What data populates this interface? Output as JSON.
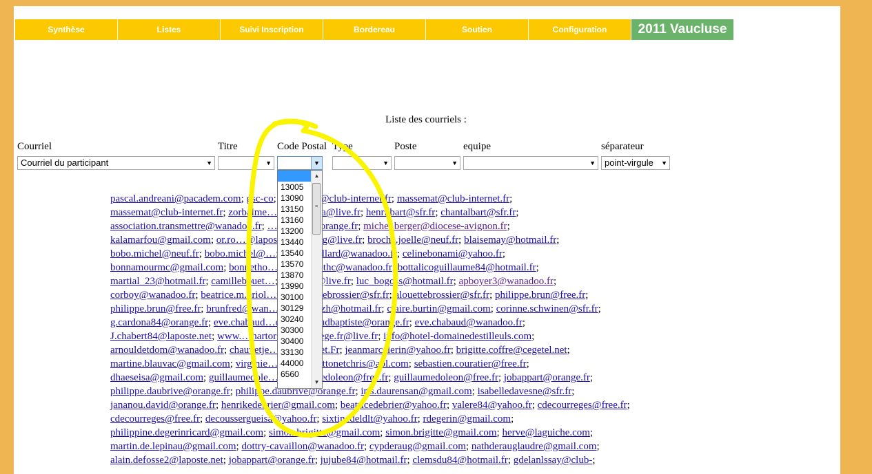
{
  "nav": {
    "items": [
      "Synthèse",
      "Listes",
      "Suivi Inscription",
      "Bordereau",
      "Soutien",
      "Configuration"
    ],
    "brand": "2011 Vaucluse"
  },
  "page_title": "Liste des courriels :",
  "filters": {
    "labels": [
      "Courriel",
      "Titre",
      "Code Postal",
      "Type",
      "Poste",
      "equipe",
      "séparateur"
    ],
    "courriel_value": "Courriel du participant",
    "separateur_value": "point-virgule"
  },
  "code_postal_options": [
    "",
    "13005",
    "13090",
    "13150",
    "13160",
    "13200",
    "13440",
    "13540",
    "13570",
    "13870",
    "13990",
    "30100",
    "30129",
    "30240",
    "30300",
    "30400",
    "33130",
    "44000",
    "6560"
  ],
  "emails": [
    [
      [
        "pascal.andreani@pacadem.com",
        ""
      ],
      [
        "gsc-co",
        "…wanadoo.fr",
        ""
      ],
      [
        "massemat@club-internet.fr",
        ""
      ],
      [
        "massemat@club-internet.fr",
        ""
      ]
    ],
    [
      [
        "massemat@club-internet.fr",
        ""
      ],
      [
        "zorbalme…ail.fr",
        ""
      ],
      [
        "arolla@live.fr",
        ""
      ],
      [
        "henri.bart@sfr.fr",
        ""
      ],
      [
        "chantalbart@sfr.fr",
        ""
      ]
    ],
    [
      [
        "association.transmettre@wanadoo.fr",
        ""
      ],
      [
        "…nique84@orange.fr",
        ""
      ],
      [
        "michel.berger@diocese-avignon.fr",
        "visited"
      ]
    ],
    [
      [
        "kalamarfou@gmail.com",
        ""
      ],
      [
        "or.ro…@lapos…",
        ""
      ],
      [
        "…yszog@live.fr",
        ""
      ],
      [
        "broche.joelle@neuf.fr",
        ""
      ],
      [
        "blaisemay@hotmail.fr",
        ""
      ]
    ],
    [
      [
        "bobo.michel@neuf.fr",
        ""
      ],
      [
        "bobo.michel@…",
        ""
      ],
      [
        "…cole.bollard@wanadoo.fr",
        ""
      ],
      [
        "celinebonami@yahoo.fr",
        ""
      ]
    ],
    [
      [
        "bonnamourmc@gmail.com",
        ""
      ],
      [
        "bonnetho…o.fr",
        ""
      ],
      [
        "bonnethc@wanadoo.fr",
        ""
      ],
      [
        "bottalicoguillaume84@hotmail.fr",
        ""
      ]
    ],
    [
      [
        "martial_23@hotmail.fr",
        ""
      ],
      [
        "camillebouet…",
        ""
      ],
      [
        "veran.84@live.fr",
        ""
      ],
      [
        "luc_bogoss@hotmail.fr",
        ""
      ],
      [
        "apboyer3@wanadoo.fr",
        "visited"
      ]
    ],
    [
      [
        "corboy@wanadoo.fr",
        ""
      ],
      [
        "beatrice.m.briol…r.fr",
        ""
      ],
      [
        "alouettebrossier@sfr.fr",
        ""
      ],
      [
        "alouettebrossier@sfr.fr",
        ""
      ],
      [
        "philippe.brun@free.fr",
        ""
      ]
    ],
    [
      [
        "philippe.brun@free.fr",
        ""
      ],
      [
        "brunfred@wan…",
        ""
      ],
      [
        "…nhbreizh@hotmail.fr",
        ""
      ],
      [
        "claire.burtin@gmail.com",
        ""
      ],
      [
        "corinne.schwinen@sfr.fr",
        ""
      ]
    ],
    [
      [
        "g.cardona84@orange.fr",
        ""
      ],
      [
        "eve.chabaud…o.fr",
        ""
      ],
      [
        "chabaudbaptiste@orange.fr",
        ""
      ],
      [
        "eve.chabaud@wanadoo.fr",
        ""
      ]
    ],
    [
      [
        "J.chabert84@laposte.net",
        ""
      ],
      [
        "www.…hartor…r.fr",
        ""
      ],
      [
        "nadege.fr@live.fr",
        ""
      ],
      [
        "info@hotel-domainedestilleuls.com",
        ""
      ]
    ],
    [
      [
        "arnouldetdom@wanadoo.fr",
        ""
      ],
      [
        "chauvetje…lub-internet.Fr",
        ""
      ],
      [
        "jeanmarcclerin@yahoo.fr",
        ""
      ],
      [
        "brigitte.coffre@cegetel.net",
        ""
      ]
    ],
    [
      [
        "martine.blauvac@gmail.com",
        ""
      ],
      [
        "virginie…@sfr.fr",
        ""
      ],
      [
        "cottonetchris@aol.com",
        ""
      ],
      [
        "sebastien.couratier@free.fr",
        ""
      ]
    ],
    [
      [
        "dhaeseisa@gmail.com",
        ""
      ],
      [
        "guillaumedole…",
        ""
      ],
      [
        "guillaumedoleon@free.fr",
        ""
      ],
      [
        "guillaumedoleon@free.fr",
        ""
      ],
      [
        "jobappart@orange.fr",
        ""
      ]
    ],
    [
      [
        "philippe.daubrive@orange.fr",
        ""
      ],
      [
        "philippe.daubrive@orange.fr",
        ""
      ],
      [
        "iris.daurensan@gmail.com",
        ""
      ],
      [
        "isabelledavesne@sfr.fr",
        ""
      ]
    ],
    [
      [
        "jananou.david@orange.fr",
        ""
      ],
      [
        "henrikedebrier@gmail.com",
        ""
      ],
      [
        "beatricedebrier@yahoo.fr",
        ""
      ],
      [
        "valere84@yahoo.fr",
        ""
      ],
      [
        "cdecourreges@free.fr",
        ""
      ]
    ],
    [
      [
        "cdecourreges@free.fr",
        ""
      ],
      [
        "decoussergueisa@yahoo.fr",
        ""
      ],
      [
        "sixtinedeldlt@yahoo.fr",
        ""
      ],
      [
        "rdegerin@gmail.com",
        ""
      ]
    ],
    [
      [
        "philippine.degerinricard@gmail.com",
        ""
      ],
      [
        "simon.brigitte@gmail.com",
        ""
      ],
      [
        "simon.brigitte@gmail.com",
        ""
      ],
      [
        "herve@laguiche.com",
        ""
      ]
    ],
    [
      [
        "martin.de.lepinau@gmail.com",
        ""
      ],
      [
        "dottry-cavaillon@wanadoo.fr",
        ""
      ],
      [
        "cypderaug@gmail.com",
        ""
      ],
      [
        "nathderauglaudre@gmail.com",
        ""
      ]
    ],
    [
      [
        "alain.defosse2@laposte.net",
        ""
      ],
      [
        "jobappart@orange.fr",
        ""
      ],
      [
        "jujube84@hotmail.fr",
        ""
      ],
      [
        "clemsdu84@hotmail.fr",
        ""
      ],
      [
        "gdelanlssay@club-",
        ""
      ]
    ]
  ]
}
